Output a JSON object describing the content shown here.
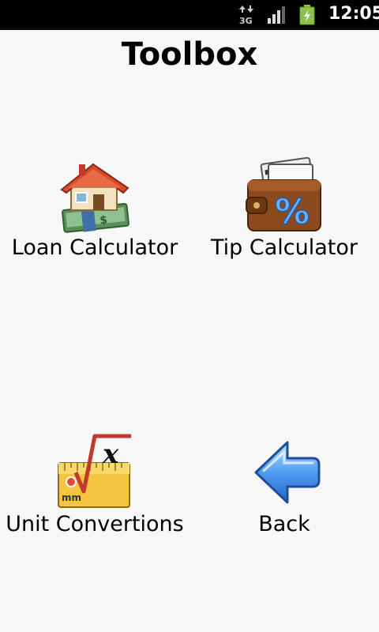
{
  "status_bar": {
    "network_icon": "3g-data-icon",
    "network_label": "3G",
    "signal_icon": "signal-strength-icon",
    "battery_icon": "battery-charging-icon",
    "time": "12:05"
  },
  "title": "Toolbox",
  "tools": [
    {
      "label": "Loan Calculator",
      "icon": "house-money-icon"
    },
    {
      "label": "Tip Calculator",
      "icon": "wallet-percent-icon"
    },
    {
      "label": "Unit Convertions",
      "icon": "ruler-formula-icon"
    },
    {
      "label": "Back",
      "icon": "back-arrow-icon"
    }
  ]
}
